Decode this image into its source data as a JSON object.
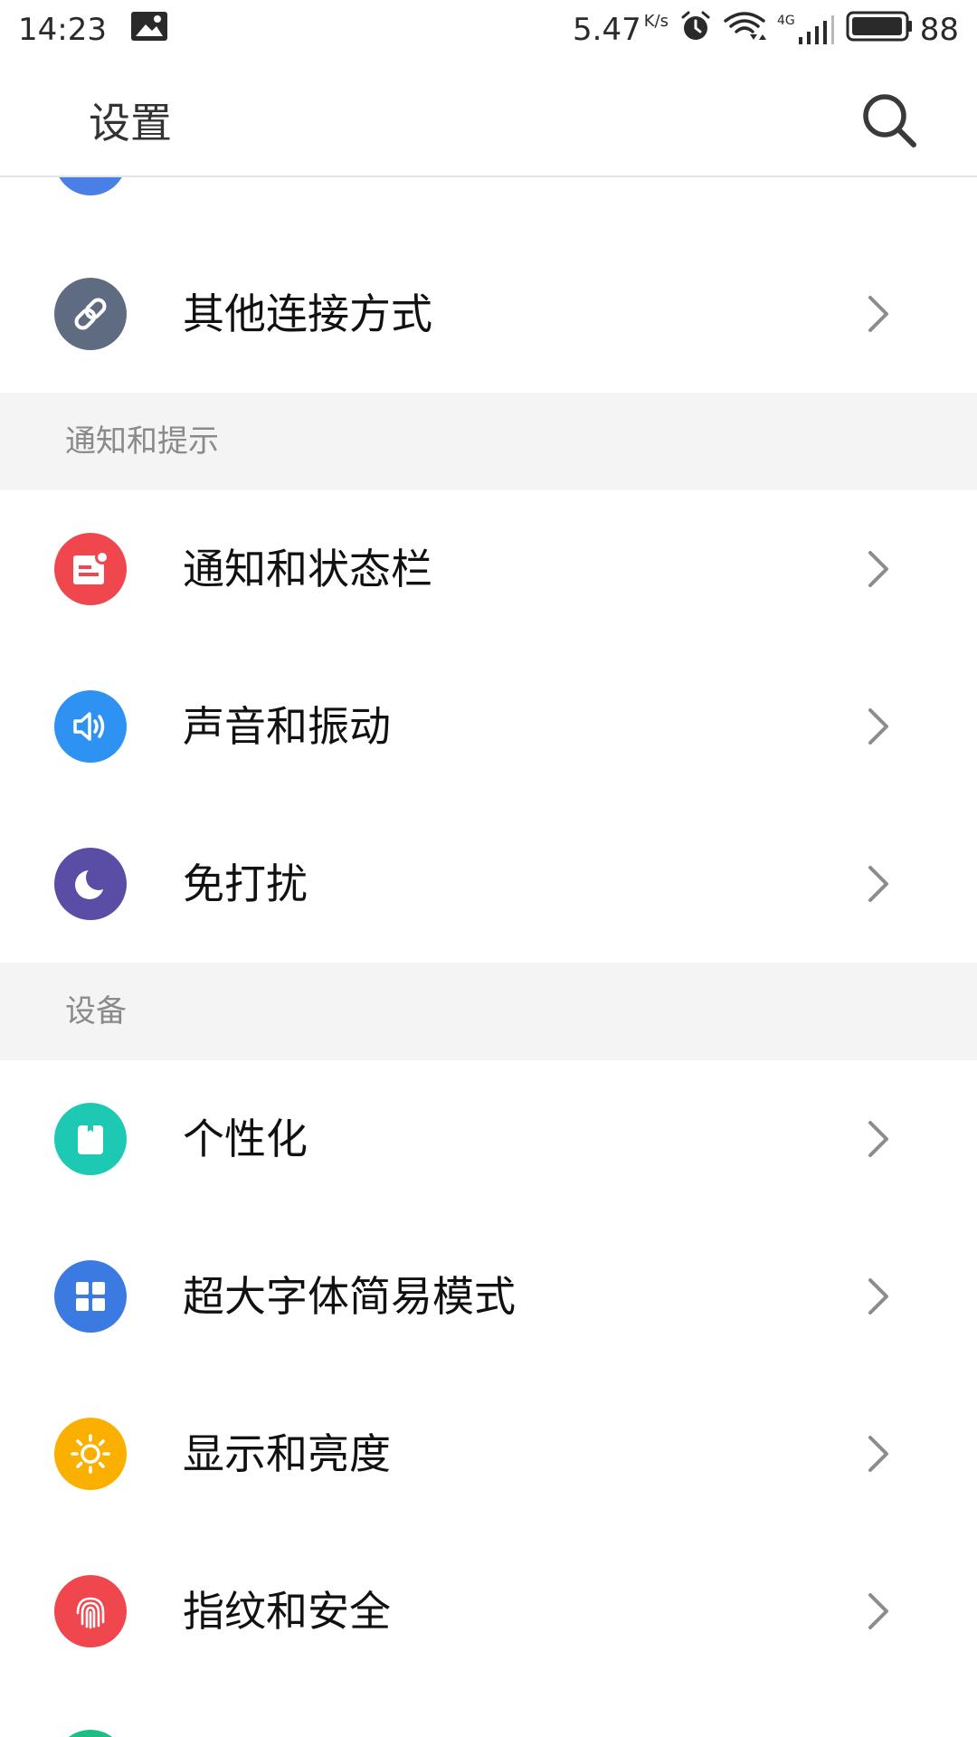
{
  "status_bar": {
    "time": "14:23",
    "net_speed": "5.47",
    "net_speed_unit": "K/s",
    "network_type": "4G",
    "battery_level": "88",
    "icons": [
      "image-notification-icon",
      "alarm-icon",
      "wifi-icon",
      "signal-icon",
      "battery-icon"
    ]
  },
  "header": {
    "title": "设置",
    "search_icon": "search-icon"
  },
  "top_item": {
    "label": "其他连接方式",
    "icon": "link-icon",
    "color": "#5f6b80"
  },
  "sections": [
    {
      "title": "通知和提示",
      "items": [
        {
          "label": "通知和状态栏",
          "icon": "notification-icon",
          "color": "#f0474f"
        },
        {
          "label": "声音和振动",
          "icon": "speaker-icon",
          "color": "#2e92f2"
        },
        {
          "label": "免打扰",
          "icon": "moon-icon",
          "color": "#5a4da6"
        }
      ]
    },
    {
      "title": "设备",
      "items": [
        {
          "label": "个性化",
          "icon": "personalize-icon",
          "color": "#1ec9b4"
        },
        {
          "label": "超大字体简易模式",
          "icon": "grid-icon",
          "color": "#3b7ae0"
        },
        {
          "label": "显示和亮度",
          "icon": "sun-icon",
          "color": "#fbb000"
        },
        {
          "label": "指纹和安全",
          "icon": "fingerprint-icon",
          "color": "#f0474f"
        }
      ]
    }
  ],
  "colors": {
    "partial_top_icon": "#4a7fe5",
    "partial_bottom_icon": "#1bbf83",
    "chevron": "#8c8c8c",
    "section_bg": "#f4f4f4"
  }
}
